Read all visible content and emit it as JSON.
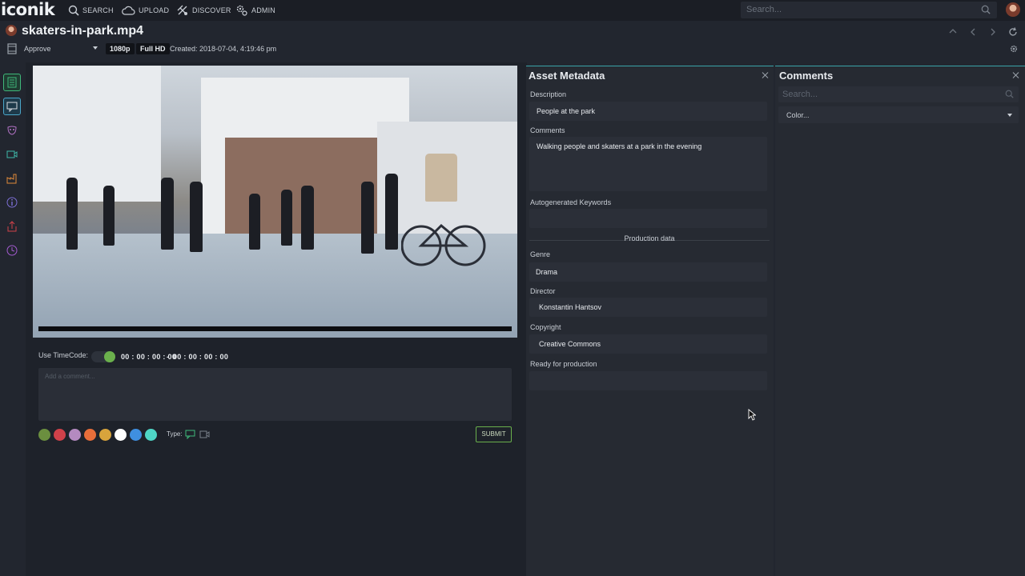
{
  "app": {
    "logo": "iconik"
  },
  "nav": {
    "search": "SEARCH",
    "upload": "UPLOAD",
    "discover": "DISCOVER",
    "admin": "ADMIN"
  },
  "top_search": {
    "placeholder": "Search..."
  },
  "asset": {
    "title": "skaters-in-park.mp4",
    "status": "Approve",
    "resolution_badge": "1080p",
    "quality_badge": "Full HD",
    "created": "Created: 2018-07-04, 4:19:46 pm"
  },
  "player": {
    "timecode_label": "Use TimeCode:",
    "timecode_in": "00 : 00 : 00 : 00",
    "timecode_sep": "-",
    "timecode_out": "00 : 00 : 00 : 00",
    "comment_placeholder": "Add a comment...",
    "type_label": "Type:",
    "submit_label": "SUBMIT",
    "colors": [
      "#6b8f3f",
      "#d0414a",
      "#b48ac0",
      "#e86e3a",
      "#d8a43c",
      "#ffffff",
      "#3f8fe0",
      "#4fd6c6"
    ]
  },
  "metadata": {
    "title": "Asset Metadata",
    "description_label": "Description",
    "description_value": "People at the park",
    "comments_label": "Comments",
    "comments_value": "Walking people and skaters at a park in the evening",
    "keywords_label": "Autogenerated Keywords",
    "keywords_value": "",
    "production_header": "Production data",
    "genre_label": "Genre",
    "genre_value": "Drama",
    "director_label": "Director",
    "director_value": "Konstantin Hantsov",
    "copyright_label": "Copyright",
    "copyright_value": "Creative Commons",
    "ready_label": "Ready for production",
    "ready_value": ""
  },
  "comments_panel": {
    "title": "Comments",
    "search_placeholder": "Search...",
    "color_filter": "Color..."
  }
}
